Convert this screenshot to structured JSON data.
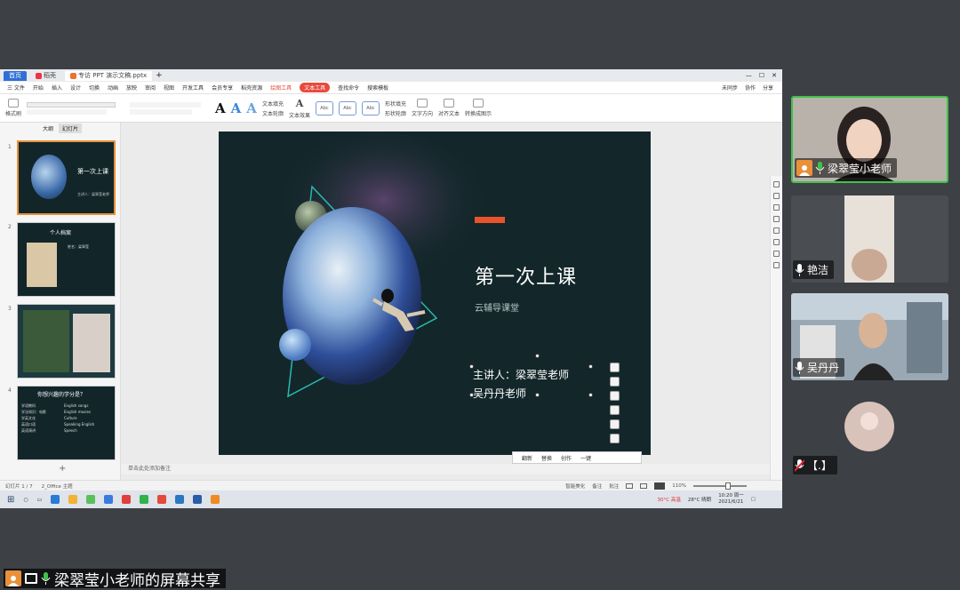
{
  "wps": {
    "tabs": [
      {
        "label": "首页",
        "kind": "home"
      },
      {
        "label": "稻壳",
        "kind": "doc"
      },
      {
        "label": "专访 PPT 演示文稿.pptx",
        "kind": "active"
      }
    ],
    "tab_add": "+",
    "window_controls": [
      "—",
      "☐",
      "✕"
    ],
    "menu": [
      "三 文件",
      "开始",
      "插入",
      "设计",
      "切换",
      "动画",
      "放映",
      "审阅",
      "视图",
      "开发工具",
      "会员专享",
      "稻壳资源",
      "绘图工具",
      "文本工具",
      "查找命令",
      "搜索模板"
    ],
    "menu_highlight_index": 13,
    "menu_active_index": 12,
    "menu_right": [
      "未同步",
      "协作",
      "分享"
    ],
    "ribbon": [
      "形状填充",
      "形状轮廓",
      "文本填充",
      "文本轮廓",
      "文本效果",
      "文字方向",
      "对齐文本",
      "转换成图示"
    ],
    "style_boxes": [
      "Abc",
      "Abc",
      "Abc"
    ]
  },
  "panel": {
    "tabs": [
      "大纲",
      "幻灯片"
    ],
    "selected_tab": 1,
    "slides": [
      {
        "num": "1",
        "title": "第一次上课",
        "sub": "主讲人：梁翠莹老师"
      },
      {
        "num": "2",
        "title": "个人档案",
        "sub": "姓名：梁翠莹"
      },
      {
        "num": "3",
        "title": "",
        "sub": ""
      },
      {
        "num": "4",
        "title": "你想兴趣的学分是？",
        "lines": [
          "学语教科",
          "English songs",
          "学法知识：电影",
          "English movies",
          "学英文化",
          "Culture",
          "英语口语",
          "Speaking English",
          "英语演讲",
          "Speech"
        ]
      }
    ],
    "add": "+"
  },
  "slide": {
    "title": "第一次上课",
    "subtitle": "云辅导课堂",
    "presenter1": "主讲人：梁翠莹老师",
    "presenter2": "吴丹丹老师",
    "colors": {
      "bg": "#13272a",
      "accent": "#e9532c"
    }
  },
  "floatbar": [
    "翻新",
    "替换",
    "创作",
    "一键"
  ],
  "notes": "单击此处添加备注",
  "status": {
    "page": "幻灯片 1 / 7",
    "theme": "2_Office 主题",
    "beautify": "智能美化",
    "notes_btn": "备注",
    "comment_btn": "批注",
    "zoom": "110%"
  },
  "taskbar": {
    "weather": "28°C 晴朗",
    "temp_alert": "30°C 高温",
    "time": "10:20 周一",
    "date": "2021/6/21"
  },
  "participants": [
    {
      "name": "梁翠莹小老师",
      "role": "host",
      "speaking": true
    },
    {
      "name": "艳洁",
      "role": "member",
      "speaking": false
    },
    {
      "name": "吴丹丹",
      "role": "member",
      "speaking": false
    },
    {
      "name": "【.】",
      "role": "member",
      "speaking": false
    }
  ],
  "share_label": "梁翠莹小老师的屏幕共享"
}
